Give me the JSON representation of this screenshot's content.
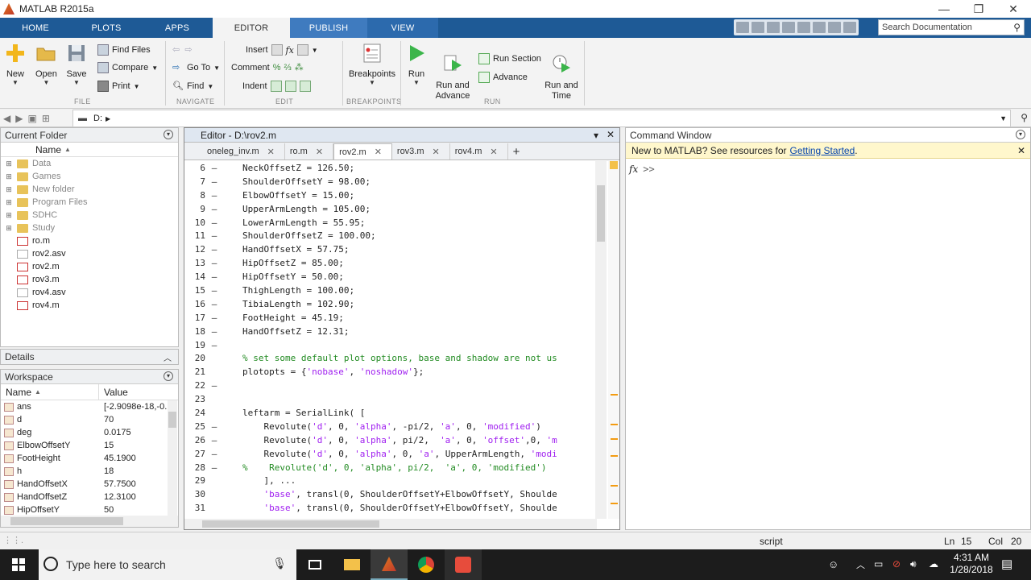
{
  "window": {
    "title": "MATLAB R2015a",
    "minimize": "—",
    "restore": "❐",
    "close": "✕"
  },
  "tabs": [
    {
      "label": "HOME"
    },
    {
      "label": "PLOTS"
    },
    {
      "label": "APPS"
    },
    {
      "label": "EDITOR"
    },
    {
      "label": "PUBLISH"
    },
    {
      "label": "VIEW"
    }
  ],
  "search": {
    "placeholder": "Search Documentation"
  },
  "ribbon": {
    "file": {
      "label": "FILE",
      "new": "New",
      "open": "Open",
      "save": "Save",
      "find_files": "Find Files",
      "compare": "Compare",
      "print": "Print"
    },
    "navigate": {
      "label": "NAVIGATE",
      "go_to": "Go To",
      "find": "Find"
    },
    "edit": {
      "label": "EDIT",
      "insert": "Insert",
      "comment": "Comment",
      "indent": "Indent"
    },
    "breakpoints": {
      "label": "BREAKPOINTS",
      "breakpoints": "Breakpoints"
    },
    "run": {
      "label": "RUN",
      "run": "Run",
      "run_and_advance": "Run and\nAdvance",
      "run_section": "Run Section",
      "advance": "Advance",
      "run_and_time": "Run and\nTime"
    }
  },
  "address": {
    "path": "D:",
    "sep": "▶"
  },
  "current_folder": {
    "title": "Current Folder",
    "column": "Name",
    "items": [
      {
        "name": "Data",
        "type": "folder"
      },
      {
        "name": "Games",
        "type": "folder"
      },
      {
        "name": "New folder",
        "type": "folder"
      },
      {
        "name": "Program Files",
        "type": "folder"
      },
      {
        "name": "SDHC",
        "type": "folder"
      },
      {
        "name": "Study",
        "type": "folder"
      },
      {
        "name": "ro.m",
        "type": "mfile"
      },
      {
        "name": "rov2.asv",
        "type": "file"
      },
      {
        "name": "rov2.m",
        "type": "mfile"
      },
      {
        "name": "rov3.m",
        "type": "mfile"
      },
      {
        "name": "rov4.asv",
        "type": "file"
      },
      {
        "name": "rov4.m",
        "type": "mfile"
      }
    ]
  },
  "details": {
    "title": "Details"
  },
  "workspace": {
    "title": "Workspace",
    "col_name": "Name",
    "col_value": "Value",
    "rows": [
      {
        "name": "ans",
        "value": "[-2.9098e-18,-0."
      },
      {
        "name": "d",
        "value": "70"
      },
      {
        "name": "deg",
        "value": "0.0175"
      },
      {
        "name": "ElbowOffsetY",
        "value": "15"
      },
      {
        "name": "FootHeight",
        "value": "45.1900"
      },
      {
        "name": "h",
        "value": "18"
      },
      {
        "name": "HandOffsetX",
        "value": "57.7500"
      },
      {
        "name": "HandOffsetZ",
        "value": "12.3100"
      },
      {
        "name": "HipOffsetY",
        "value": "50"
      }
    ]
  },
  "editor": {
    "title": "Editor - D:\\rov2.m",
    "tabs": [
      {
        "label": "oneleg_inv.m",
        "close": "✕"
      },
      {
        "label": "ro.m",
        "close": "✕"
      },
      {
        "label": "rov2.m",
        "close": "✕"
      },
      {
        "label": "rov3.m",
        "close": "✕"
      },
      {
        "label": "rov4.m",
        "close": "✕"
      }
    ],
    "add_tab": "+",
    "lines": [
      {
        "n": "6",
        "d": "–",
        "segs": [
          {
            "t": "NeckOffsetZ = 126.50;",
            "c": ""
          }
        ]
      },
      {
        "n": "7",
        "d": "–",
        "segs": [
          {
            "t": "ShoulderOffsetY = 98.00;",
            "c": ""
          }
        ]
      },
      {
        "n": "8",
        "d": "–",
        "segs": [
          {
            "t": "ElbowOffsetY = 15.00;",
            "c": ""
          }
        ]
      },
      {
        "n": "9",
        "d": "–",
        "segs": [
          {
            "t": "UpperArmLength = 105.00;",
            "c": ""
          }
        ]
      },
      {
        "n": "10",
        "d": "–",
        "segs": [
          {
            "t": "LowerArmLength = 55.95;",
            "c": ""
          }
        ]
      },
      {
        "n": "11",
        "d": "–",
        "segs": [
          {
            "t": "ShoulderOffsetZ = 100.00;",
            "c": ""
          }
        ]
      },
      {
        "n": "12",
        "d": "–",
        "segs": [
          {
            "t": "HandOffsetX = 57.75;",
            "c": ""
          }
        ]
      },
      {
        "n": "13",
        "d": "–",
        "segs": [
          {
            "t": "HipOffsetZ = 85.00;",
            "c": ""
          }
        ]
      },
      {
        "n": "14",
        "d": "–",
        "segs": [
          {
            "t": "HipOffsetY = 50.00;",
            "c": ""
          }
        ]
      },
      {
        "n": "15",
        "d": "–",
        "segs": [
          {
            "t": "ThighLength = 100.00;",
            "c": ""
          }
        ]
      },
      {
        "n": "16",
        "d": "–",
        "segs": [
          {
            "t": "TibiaLength = 102.90;",
            "c": ""
          }
        ]
      },
      {
        "n": "17",
        "d": "–",
        "segs": [
          {
            "t": "FootHeight = 45.19;",
            "c": ""
          }
        ]
      },
      {
        "n": "18",
        "d": "–",
        "segs": [
          {
            "t": "HandOffsetZ = 12.31;",
            "c": ""
          }
        ]
      },
      {
        "n": "19",
        "d": "–",
        "segs": [
          {
            "t": "",
            "c": ""
          }
        ]
      },
      {
        "n": "20",
        "d": "",
        "segs": [
          {
            "t": "% set some default plot options, base and shadow are not us",
            "c": "cm"
          }
        ]
      },
      {
        "n": "21",
        "d": "",
        "segs": [
          {
            "t": "plotopts = {",
            "c": ""
          },
          {
            "t": "'nobase'",
            "c": "st"
          },
          {
            "t": ", ",
            "c": ""
          },
          {
            "t": "'noshadow'",
            "c": "st"
          },
          {
            "t": "};",
            "c": ""
          }
        ]
      },
      {
        "n": "22",
        "d": "–",
        "segs": [
          {
            "t": "",
            "c": ""
          }
        ]
      },
      {
        "n": "23",
        "d": "",
        "segs": [
          {
            "t": "",
            "c": ""
          }
        ]
      },
      {
        "n": "24",
        "d": "",
        "segs": [
          {
            "t": "leftarm = SerialLink( [",
            "c": ""
          }
        ]
      },
      {
        "n": "25",
        "d": "–",
        "segs": [
          {
            "t": "    Revolute(",
            "c": ""
          },
          {
            "t": "'d'",
            "c": "st"
          },
          {
            "t": ", 0, ",
            "c": ""
          },
          {
            "t": "'alpha'",
            "c": "st"
          },
          {
            "t": ", -pi/2, ",
            "c": ""
          },
          {
            "t": "'a'",
            "c": "st"
          },
          {
            "t": ", 0, ",
            "c": ""
          },
          {
            "t": "'modified'",
            "c": "st"
          },
          {
            "t": ")",
            "c": ""
          }
        ]
      },
      {
        "n": "26",
        "d": "–",
        "segs": [
          {
            "t": "    Revolute(",
            "c": ""
          },
          {
            "t": "'d'",
            "c": "st"
          },
          {
            "t": ", 0, ",
            "c": ""
          },
          {
            "t": "'alpha'",
            "c": "st"
          },
          {
            "t": ", pi/2,  ",
            "c": ""
          },
          {
            "t": "'a'",
            "c": "st"
          },
          {
            "t": ", 0, ",
            "c": ""
          },
          {
            "t": "'offset'",
            "c": "st"
          },
          {
            "t": ",0, ",
            "c": ""
          },
          {
            "t": "'m",
            "c": "st"
          }
        ]
      },
      {
        "n": "27",
        "d": "–",
        "segs": [
          {
            "t": "    Revolute(",
            "c": ""
          },
          {
            "t": "'d'",
            "c": "st"
          },
          {
            "t": ", 0, ",
            "c": ""
          },
          {
            "t": "'alpha'",
            "c": "st"
          },
          {
            "t": ", 0, ",
            "c": ""
          },
          {
            "t": "'a'",
            "c": "st"
          },
          {
            "t": ", UpperArmLength, ",
            "c": ""
          },
          {
            "t": "'modi",
            "c": "st"
          }
        ]
      },
      {
        "n": "28",
        "d": "–",
        "segs": [
          {
            "t": "%    Revolute('d', 0, 'alpha', pi/2,  'a', 0, 'modified')",
            "c": "cm"
          }
        ]
      },
      {
        "n": "29",
        "d": "",
        "segs": [
          {
            "t": "    ], ...",
            "c": ""
          }
        ]
      },
      {
        "n": "30",
        "d": "",
        "segs": [
          {
            "t": "    ",
            "c": ""
          },
          {
            "t": "'base'",
            "c": "st"
          },
          {
            "t": ", transl(0, ShoulderOffsetY+ElbowOffsetY, Shoulde",
            "c": ""
          }
        ]
      },
      {
        "n": "31",
        "d": "",
        "segs": [
          {
            "t": "    ",
            "c": ""
          },
          {
            "t": "'base'",
            "c": "st"
          },
          {
            "t": ", transl(0, ShoulderOffsetY+ElbowOffsetY, Shoulde",
            "c": ""
          }
        ]
      }
    ]
  },
  "command_window": {
    "title": "Command Window",
    "banner_text": "New to MATLAB? See resources for",
    "banner_link": "Getting Started",
    "banner_end": ".",
    "fx": "fx",
    "prompt": ">>"
  },
  "status": {
    "mode": "script",
    "ln_label": "Ln",
    "ln": "15",
    "col_label": "Col",
    "col": "20"
  },
  "taskbar": {
    "search_placeholder": "Type here to search",
    "time": "4:31 AM",
    "date": "1/28/2018"
  },
  "colors": {
    "ribbon_tab": "#1e5a96",
    "comment": "#228B22",
    "string": "#a020f0",
    "link": "#0645ad"
  }
}
